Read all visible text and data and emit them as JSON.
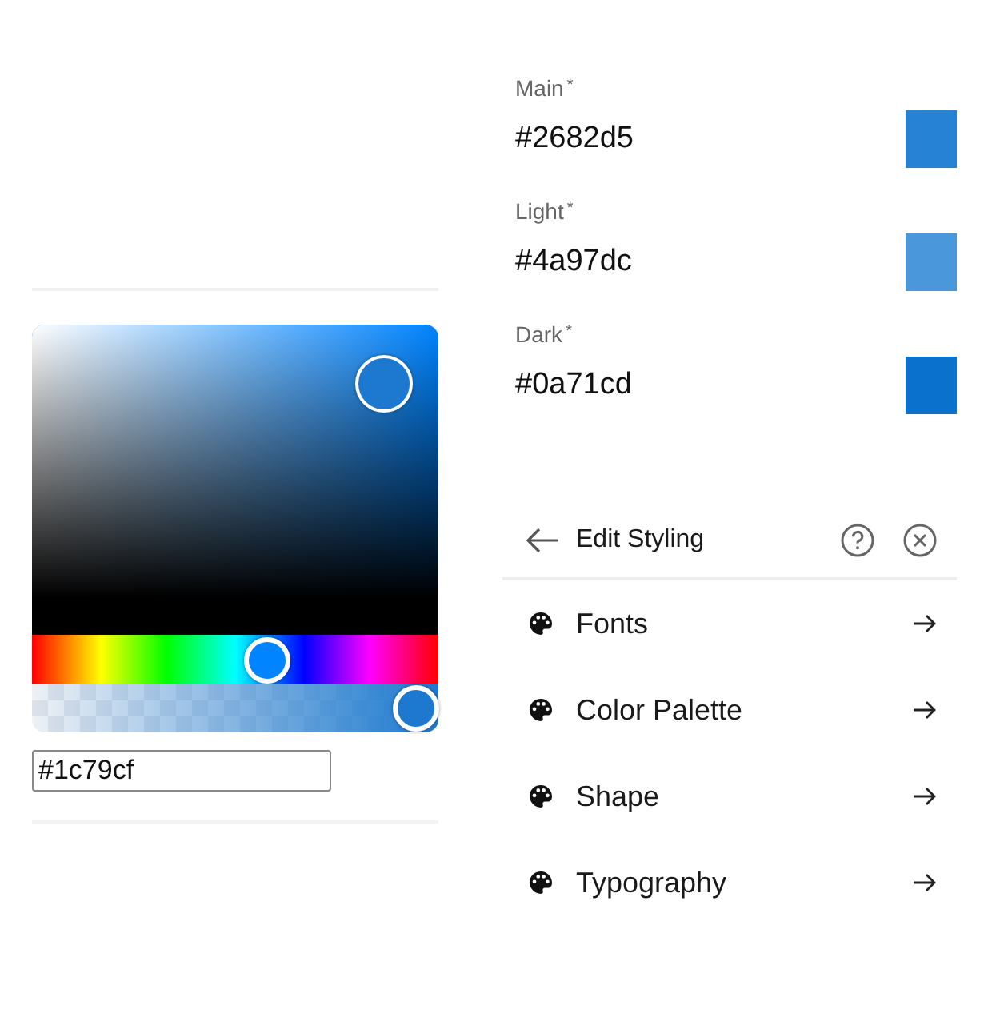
{
  "picker": {
    "value": "#1c79cf",
    "alpha": {
      "level": 1
    }
  },
  "palette": [
    {
      "label": "Main",
      "required_mark": "*",
      "value": "#2682d5"
    },
    {
      "label": "Light",
      "required_mark": "*",
      "value": "#4a97dc"
    },
    {
      "label": "Dark",
      "required_mark": "*",
      "value": "#0a71cd"
    }
  ],
  "panel": {
    "title": "Edit Styling",
    "items": [
      {
        "label": "Fonts"
      },
      {
        "label": "Color Palette"
      },
      {
        "label": "Shape"
      },
      {
        "label": "Typography"
      }
    ]
  }
}
